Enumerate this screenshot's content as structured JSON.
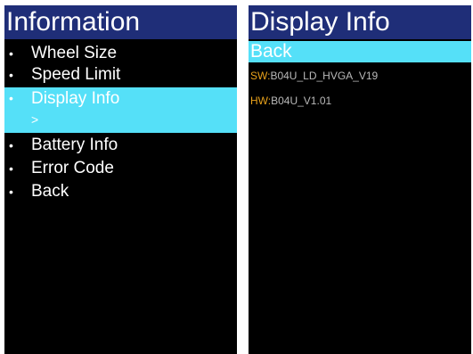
{
  "left_screen": {
    "title": "Information",
    "bullet": "•",
    "items": [
      {
        "label": "Wheel Size"
      },
      {
        "label": "Speed Limit"
      },
      {
        "label": "Display Info",
        "sub": ">"
      },
      {
        "label": "Battery Info"
      },
      {
        "label": "Error Code"
      },
      {
        "label": "Back"
      }
    ]
  },
  "right_screen": {
    "title": "Display Info",
    "back_label": "Back",
    "sw": {
      "key": "SW:",
      "value": "B04U_LD_HVGA_V19"
    },
    "hw": {
      "key": "HW:",
      "value": "B04U_V1.01"
    }
  },
  "colors": {
    "title_bar": "#1f2e78",
    "highlight": "#55e0f8",
    "background": "#000000",
    "key_label": "#e9a21b",
    "value_text": "#b9b9b9"
  }
}
